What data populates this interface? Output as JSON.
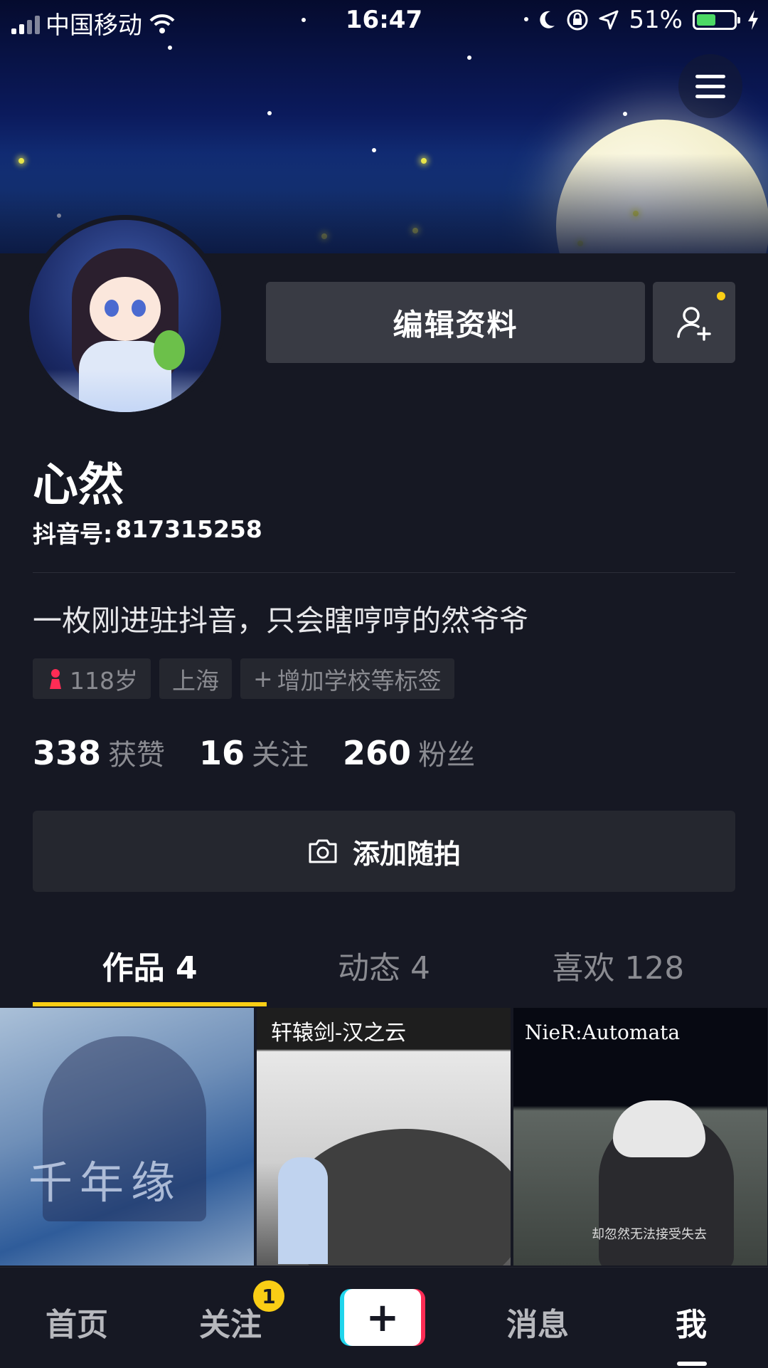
{
  "status_bar": {
    "carrier": "中国移动",
    "time": "16:47",
    "battery_percent": "51%",
    "battery_level": 0.51,
    "battery_color": "#4cd964"
  },
  "header": {
    "menu_icon": "hamburger-menu-icon"
  },
  "profile": {
    "edit_button": "编辑资料",
    "add_friend_icon": "add-friend-icon",
    "nickname": "心然",
    "douyin_id_label": "抖音号:",
    "douyin_id": "817315258",
    "bio": "一枚刚进驻抖音，只会瞎哼哼的然爷爷",
    "tags": {
      "age": "118岁",
      "city": "上海",
      "add_tag": "增加学校等标签"
    },
    "stats": [
      {
        "value": "338",
        "label": "获赞"
      },
      {
        "value": "16",
        "label": "关注"
      },
      {
        "value": "260",
        "label": "粉丝"
      }
    ],
    "add_suipai": "添加随拍"
  },
  "tabs": [
    {
      "label": "作品 4",
      "active": true
    },
    {
      "label": "动态 4",
      "active": false
    },
    {
      "label": "喜欢 128",
      "active": false
    }
  ],
  "grid": {
    "thumb1_title": "千年缘",
    "thumb2_title": "轩辕剑-汉之云",
    "thumb3_title": "NieR:Automata",
    "thumb3_sub": "却忽然无法接受失去"
  },
  "bottom_nav": {
    "home": "首页",
    "follow": "关注",
    "follow_badge": "1",
    "create": "+",
    "messages": "消息",
    "me": "我"
  },
  "colors": {
    "background": "#161823",
    "accent_yellow": "#face15",
    "tiktok_cyan": "#20d5ec",
    "tiktok_red": "#fe2c55"
  }
}
